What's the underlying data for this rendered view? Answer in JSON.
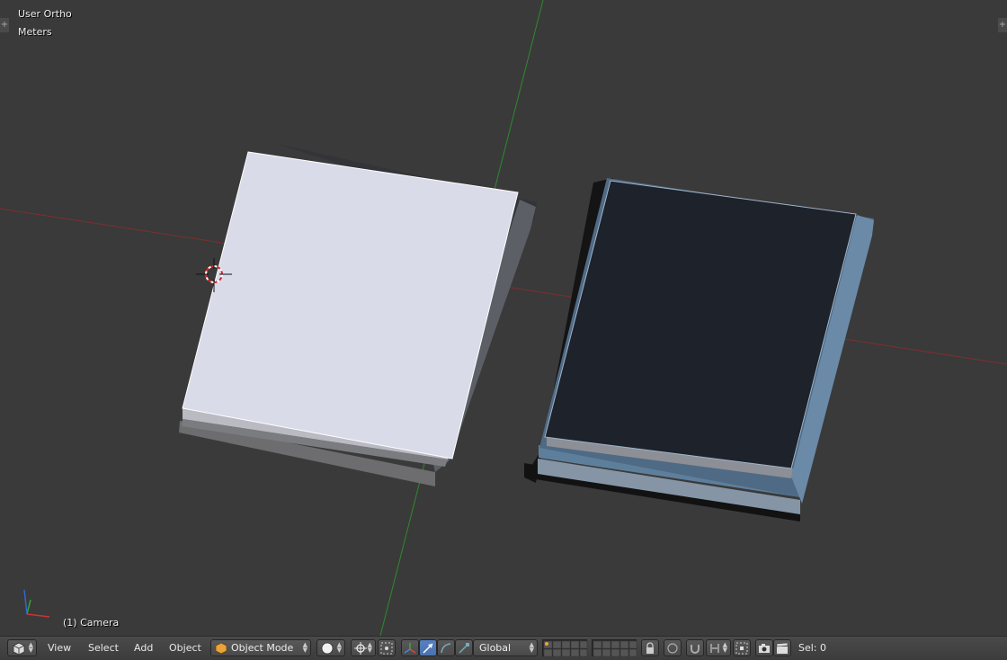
{
  "viewport": {
    "view_name": "User Ortho",
    "units": "Meters",
    "active_object": "(1) Camera"
  },
  "header": {
    "menus": [
      "View",
      "Select",
      "Add",
      "Object"
    ],
    "mode": "Object Mode",
    "orientation": "Global",
    "selection_count": "Sel: 0"
  },
  "colors": {
    "background": "#3a3a3a",
    "x_axis": "#8b2a2a",
    "y_axis": "#2f8f2f",
    "accent": "#5680c2",
    "selected_object": "#5b7fa0"
  }
}
